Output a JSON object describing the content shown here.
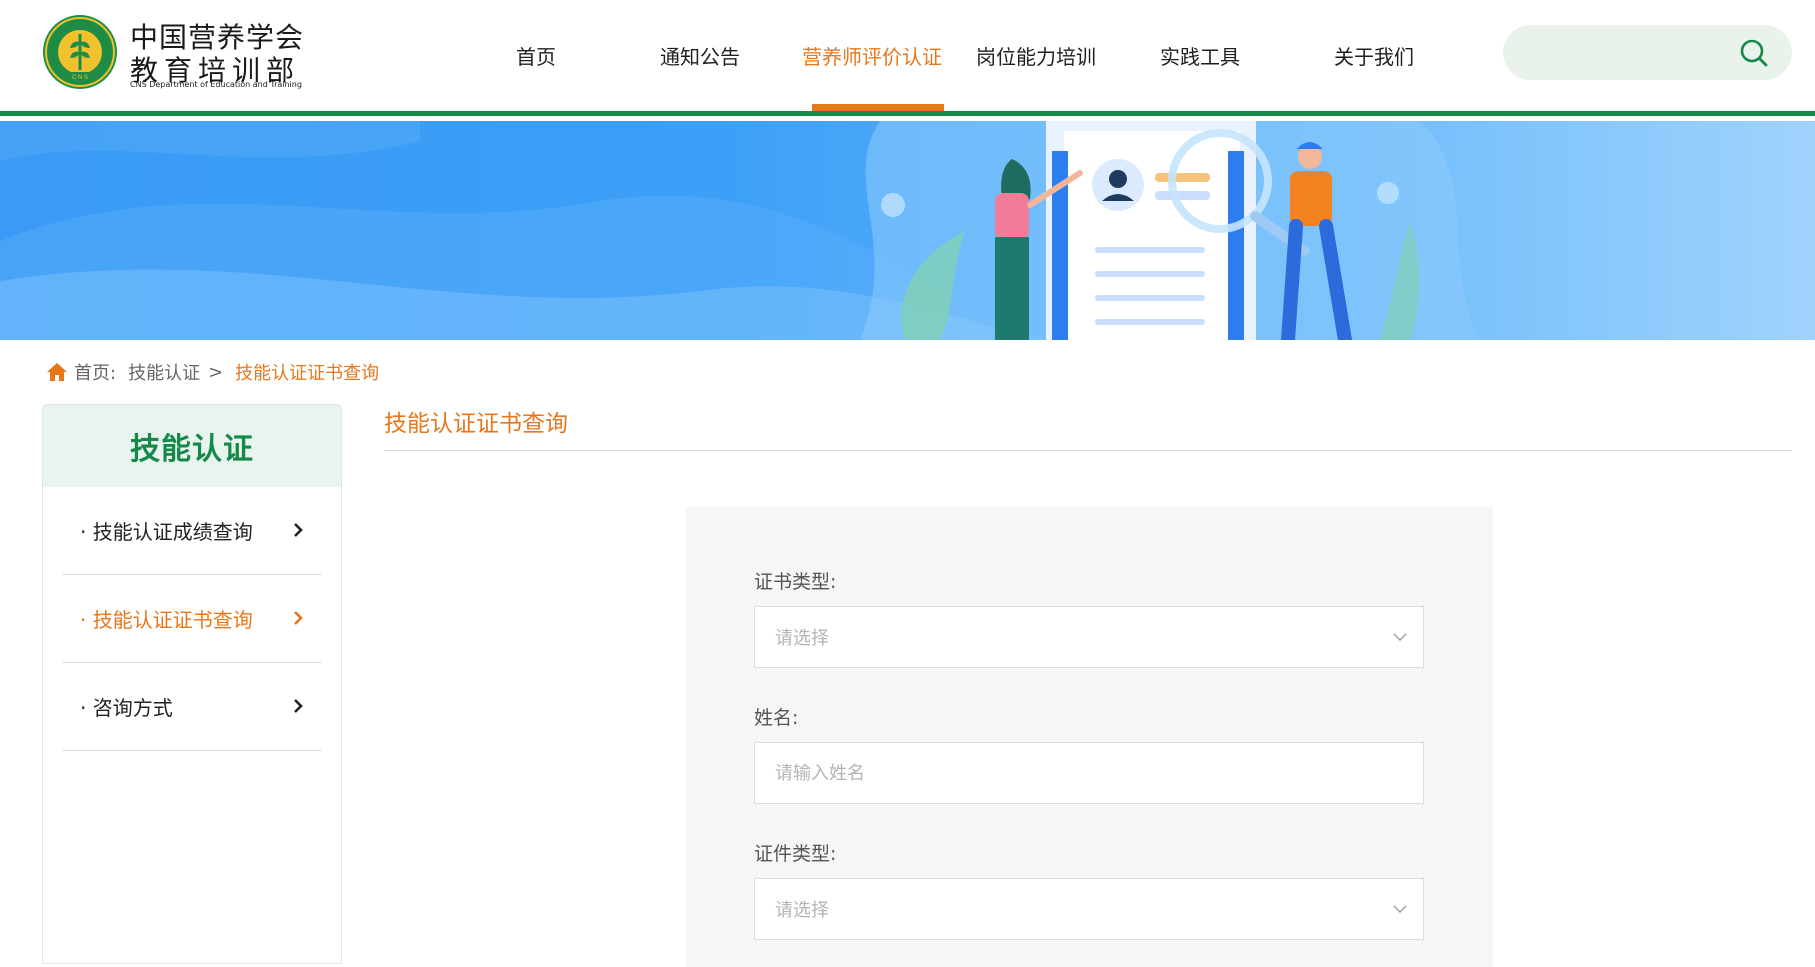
{
  "header": {
    "org_name_line1": "中国营养学会",
    "org_name_line2": "教育培训部",
    "org_name_en": "CNS Department of Education and Training",
    "logo_ring_text": "中国营养学会",
    "logo_bottom_text": "CNS",
    "nav": [
      {
        "label": "首页",
        "active": false
      },
      {
        "label": "通知公告",
        "active": false
      },
      {
        "label": "营养师评价认证",
        "active": true
      },
      {
        "label": "岗位能力培训",
        "active": false
      },
      {
        "label": "实践工具",
        "active": false
      },
      {
        "label": "关于我们",
        "active": false
      }
    ],
    "search": {
      "placeholder": "",
      "value": "",
      "icon": "search-icon"
    }
  },
  "breadcrumb": {
    "home_label": "首页:",
    "parent_label": "技能认证",
    "separator": ">",
    "current_label": "技能认证证书查询"
  },
  "sidebar": {
    "title": "技能认证",
    "items": [
      {
        "label": "· 技能认证成绩查询",
        "active": false
      },
      {
        "label": "· 技能认证证书查询",
        "active": true
      },
      {
        "label": "· 咨询方式",
        "active": false
      }
    ]
  },
  "main": {
    "title": "技能认证证书查询",
    "form": {
      "cert_type_label": "证书类型:",
      "cert_type_placeholder": "请选择",
      "name_label": "姓名:",
      "name_placeholder": "请输入姓名",
      "id_type_label": "证件类型:",
      "id_type_placeholder": "请选择"
    }
  },
  "colors": {
    "brand_green": "#15894a",
    "accent_orange": "#e8761a",
    "banner_blue": "#3a9af5",
    "search_bg": "#e9f3ec"
  }
}
